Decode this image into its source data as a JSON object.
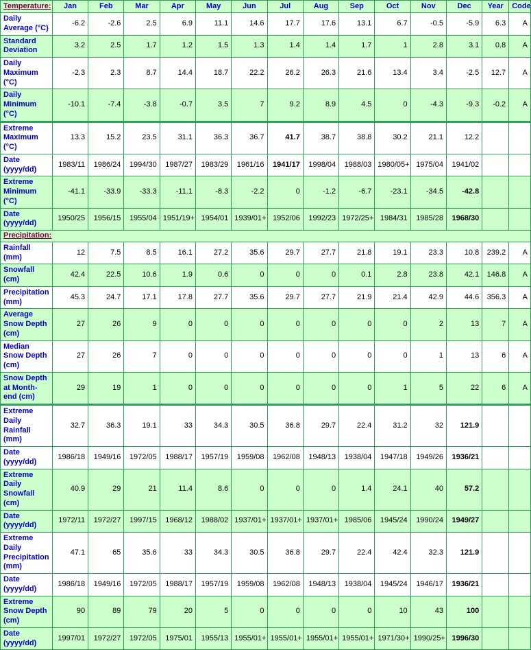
{
  "table": {
    "columns": [
      "Jan",
      "Feb",
      "Mar",
      "Apr",
      "May",
      "Jun",
      "Jul",
      "Aug",
      "Sep",
      "Oct",
      "Nov",
      "Dec",
      "Year",
      "Code"
    ],
    "sections": [
      {
        "title": "Temperature:"
      },
      {
        "title": "Precipitation:"
      }
    ],
    "rows": [
      {
        "label": "Daily Average (°C)",
        "shade": false,
        "sep": false,
        "values": [
          "-6.2",
          "-2.6",
          "2.5",
          "6.9",
          "11.1",
          "14.6",
          "17.7",
          "17.6",
          "13.1",
          "6.7",
          "-0.5",
          "-5.9",
          "6.3",
          "A"
        ],
        "bold": []
      },
      {
        "label": "Standard Deviation",
        "shade": true,
        "sep": false,
        "values": [
          "3.2",
          "2.5",
          "1.7",
          "1.2",
          "1.5",
          "1.3",
          "1.4",
          "1.4",
          "1.7",
          "1",
          "2.8",
          "3.1",
          "0.8",
          "A"
        ],
        "bold": []
      },
      {
        "label": "Daily Maximum (°C)",
        "shade": false,
        "sep": false,
        "values": [
          "-2.3",
          "2.3",
          "8.7",
          "14.4",
          "18.7",
          "22.2",
          "26.2",
          "26.3",
          "21.6",
          "13.4",
          "3.4",
          "-2.5",
          "12.7",
          "A"
        ],
        "bold": []
      },
      {
        "label": "Daily Minimum (°C)",
        "shade": true,
        "sep": false,
        "values": [
          "-10.1",
          "-7.4",
          "-3.8",
          "-0.7",
          "3.5",
          "7",
          "9.2",
          "8.9",
          "4.5",
          "0",
          "-4.3",
          "-9.3",
          "-0.2",
          "A"
        ],
        "bold": []
      },
      {
        "label": "Extreme Maximum (°C)",
        "shade": false,
        "sep": true,
        "values": [
          "13.3",
          "15.2",
          "23.5",
          "31.1",
          "36.3",
          "36.7",
          "41.7",
          "38.7",
          "38.8",
          "30.2",
          "21.1",
          "12.2",
          "",
          ""
        ],
        "bold": [
          6
        ]
      },
      {
        "label": "Date (yyyy/dd)",
        "shade": false,
        "sep": false,
        "values": [
          "1983/11",
          "1986/24",
          "1994/30",
          "1987/27",
          "1983/29",
          "1961/16",
          "1941/17",
          "1998/04",
          "1988/03",
          "1980/05+",
          "1975/04",
          "1941/02",
          "",
          ""
        ],
        "bold": [
          6
        ]
      },
      {
        "label": "Extreme Minimum (°C)",
        "shade": true,
        "sep": false,
        "values": [
          "-41.1",
          "-33.9",
          "-33.3",
          "-11.1",
          "-8.3",
          "-2.2",
          "0",
          "-1.2",
          "-6.7",
          "-23.1",
          "-34.5",
          "-42.8",
          "",
          ""
        ],
        "bold": [
          11
        ]
      },
      {
        "label": "Date (yyyy/dd)",
        "shade": true,
        "sep": false,
        "values": [
          "1950/25",
          "1956/15",
          "1955/04",
          "1951/19+",
          "1954/01",
          "1939/01+",
          "1952/06",
          "1992/23",
          "1972/25+",
          "1984/31",
          "1985/28",
          "1968/30",
          "",
          ""
        ],
        "bold": [
          11
        ]
      },
      {
        "label": "Rainfall (mm)",
        "shade": false,
        "sep": false,
        "values": [
          "12",
          "7.5",
          "8.5",
          "16.1",
          "27.2",
          "35.6",
          "29.7",
          "27.7",
          "21.8",
          "19.1",
          "23.3",
          "10.8",
          "239.2",
          "A"
        ],
        "bold": []
      },
      {
        "label": "Snowfall (cm)",
        "shade": true,
        "sep": false,
        "values": [
          "42.4",
          "22.5",
          "10.6",
          "1.9",
          "0.6",
          "0",
          "0",
          "0",
          "0.1",
          "2.8",
          "23.8",
          "42.1",
          "146.8",
          "A"
        ],
        "bold": []
      },
      {
        "label": "Precipitation (mm)",
        "shade": false,
        "sep": false,
        "values": [
          "45.3",
          "24.7",
          "17.1",
          "17.8",
          "27.7",
          "35.6",
          "29.7",
          "27.7",
          "21.9",
          "21.4",
          "42.9",
          "44.6",
          "356.3",
          "A"
        ],
        "bold": []
      },
      {
        "label": "Average Snow Depth (cm)",
        "shade": true,
        "sep": false,
        "values": [
          "27",
          "26",
          "9",
          "0",
          "0",
          "0",
          "0",
          "0",
          "0",
          "0",
          "2",
          "13",
          "7",
          "A"
        ],
        "bold": []
      },
      {
        "label": "Median Snow Depth (cm)",
        "shade": false,
        "sep": false,
        "values": [
          "27",
          "26",
          "7",
          "0",
          "0",
          "0",
          "0",
          "0",
          "0",
          "0",
          "1",
          "13",
          "6",
          "A"
        ],
        "bold": []
      },
      {
        "label": "Snow Depth at Month-end (cm)",
        "shade": true,
        "sep": false,
        "values": [
          "29",
          "19",
          "1",
          "0",
          "0",
          "0",
          "0",
          "0",
          "0",
          "1",
          "5",
          "22",
          "6",
          "A"
        ],
        "bold": []
      },
      {
        "label": "Extreme Daily Rainfall (mm)",
        "shade": false,
        "sep": true,
        "values": [
          "32.7",
          "36.3",
          "19.1",
          "33",
          "34.3",
          "30.5",
          "36.8",
          "29.7",
          "22.4",
          "31.2",
          "32",
          "121.9",
          "",
          ""
        ],
        "bold": [
          11
        ]
      },
      {
        "label": "Date (yyyy/dd)",
        "shade": false,
        "sep": false,
        "values": [
          "1986/18",
          "1949/16",
          "1972/05",
          "1988/17",
          "1957/19",
          "1959/08",
          "1962/08",
          "1948/13",
          "1938/04",
          "1947/18",
          "1949/26",
          "1936/21",
          "",
          ""
        ],
        "bold": [
          11
        ]
      },
      {
        "label": "Extreme Daily Snowfall (cm)",
        "shade": true,
        "sep": false,
        "values": [
          "40.9",
          "29",
          "21",
          "11.4",
          "8.6",
          "0",
          "0",
          "0",
          "1.4",
          "24.1",
          "40",
          "57.2",
          "",
          ""
        ],
        "bold": [
          11
        ]
      },
      {
        "label": "Date (yyyy/dd)",
        "shade": true,
        "sep": false,
        "values": [
          "1972/11",
          "1972/27",
          "1997/15",
          "1968/12",
          "1988/02",
          "1937/01+",
          "1937/01+",
          "1937/01+",
          "1985/06",
          "1945/24",
          "1990/24",
          "1949/27",
          "",
          ""
        ],
        "bold": [
          11
        ]
      },
      {
        "label": "Extreme Daily Precipitation (mm)",
        "shade": false,
        "sep": false,
        "values": [
          "47.1",
          "65",
          "35.6",
          "33",
          "34.3",
          "30.5",
          "36.8",
          "29.7",
          "22.4",
          "42.4",
          "32.3",
          "121.9",
          "",
          ""
        ],
        "bold": [
          11
        ]
      },
      {
        "label": "Date (yyyy/dd)",
        "shade": false,
        "sep": false,
        "values": [
          "1986/18",
          "1949/16",
          "1972/05",
          "1988/17",
          "1957/19",
          "1959/08",
          "1962/08",
          "1948/13",
          "1938/04",
          "1945/24",
          "1946/17",
          "1936/21",
          "",
          ""
        ],
        "bold": [
          11
        ]
      },
      {
        "label": "Extreme Snow Depth (cm)",
        "shade": true,
        "sep": false,
        "values": [
          "90",
          "89",
          "79",
          "20",
          "5",
          "0",
          "0",
          "0",
          "0",
          "10",
          "43",
          "100",
          "",
          ""
        ],
        "bold": [
          11
        ]
      },
      {
        "label": "Date (yyyy/dd)",
        "shade": true,
        "sep": false,
        "values": [
          "1997/01",
          "1972/27",
          "1972/05",
          "1975/01",
          "1955/13",
          "1955/01+",
          "1955/01+",
          "1955/01+",
          "1955/01+",
          "1971/30+",
          "1990/25+",
          "1996/30",
          "",
          ""
        ],
        "bold": [
          11
        ]
      }
    ],
    "section_row_index": 8,
    "colors": {
      "shade_green": "#ccffcc",
      "border_green": "#2e9e5b",
      "label_blue": "#0000cc",
      "section_maroon": "#800040",
      "value_black": "#000000"
    }
  }
}
